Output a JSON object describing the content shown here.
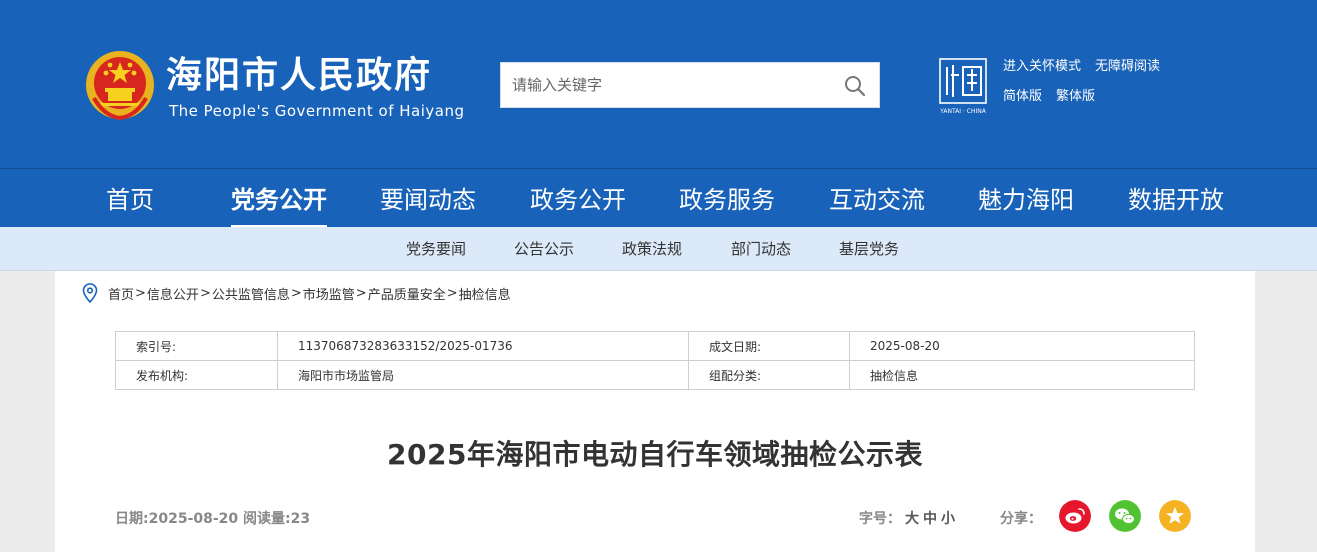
{
  "header": {
    "site_title": "海阳市人民政府",
    "site_subtitle": "The People's Government of Haiyang",
    "search_placeholder": "请输入关键字",
    "yantai_logo_text": "YANTAI · CHINA",
    "top_links": [
      "进入关怀模式",
      "无障碍阅读",
      "简体版",
      "繁体版"
    ]
  },
  "nav": {
    "items": [
      "首页",
      "党务公开",
      "要闻动态",
      "政务公开",
      "政务服务",
      "互动交流",
      "魅力海阳",
      "数据开放"
    ],
    "active": "党务公开"
  },
  "subnav": {
    "items": [
      "党务要闻",
      "公告公示",
      "政策法规",
      "部门动态",
      "基层党务"
    ]
  },
  "breadcrumb": [
    "首页",
    "信息公开",
    "公共监管信息",
    "市场监管",
    "产品质量安全",
    "抽检信息"
  ],
  "meta": {
    "index_label": "索引号:",
    "index_value": "113706873283633152/2025-01736",
    "date_label": "成文日期:",
    "date_value": "2025-08-20",
    "org_label": "发布机构:",
    "org_value": "海阳市市场监管局",
    "category_label": "组配分类:",
    "category_value": "抽检信息"
  },
  "article": {
    "title": "2025年海阳市电动自行车领域抽检公示表",
    "info": "日期:2025-08-20 阅读量:23",
    "fontsize_label": "字号：",
    "fontsize_options": [
      "大",
      "中",
      "小"
    ],
    "share_label": "分享："
  },
  "colors": {
    "brand_blue": "#1862b9",
    "subnav_bg": "#dbe9f8",
    "weibo": "#e6162d",
    "wechat": "#51c332",
    "qzone": "#f5b324"
  }
}
